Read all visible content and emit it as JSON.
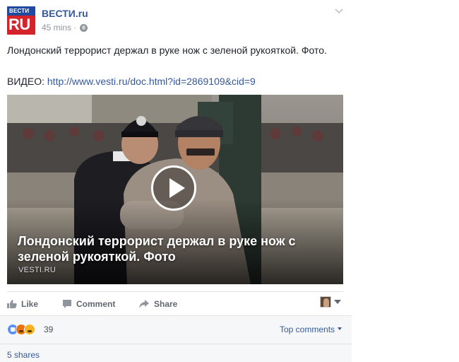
{
  "post": {
    "page_name": "ВЕСТИ.ru",
    "time": "45 mins",
    "separator": "·",
    "logo_top": "ВЕСТИ",
    "logo_bottom": "RU",
    "text": "Лондонский террорист держал в руке нож с зеленой рукояткой. Фото.",
    "video_prefix": "ВИДЕО: ",
    "video_link": "http://www.vesti.ru/doc.html?id=2869109&cid=9"
  },
  "video": {
    "title": "Лондонский террорист держал в руке нож с зеленой рукояткой. Фото",
    "source": "VESTI.RU"
  },
  "actions": {
    "like": "Like",
    "comment": "Comment",
    "share": "Share"
  },
  "reactions": {
    "count": "39",
    "top_comments": "Top comments"
  },
  "shares": "5 shares",
  "colors": {
    "link": "#365899",
    "brand_red": "#d5232b",
    "brand_blue": "#1f4aa0"
  }
}
